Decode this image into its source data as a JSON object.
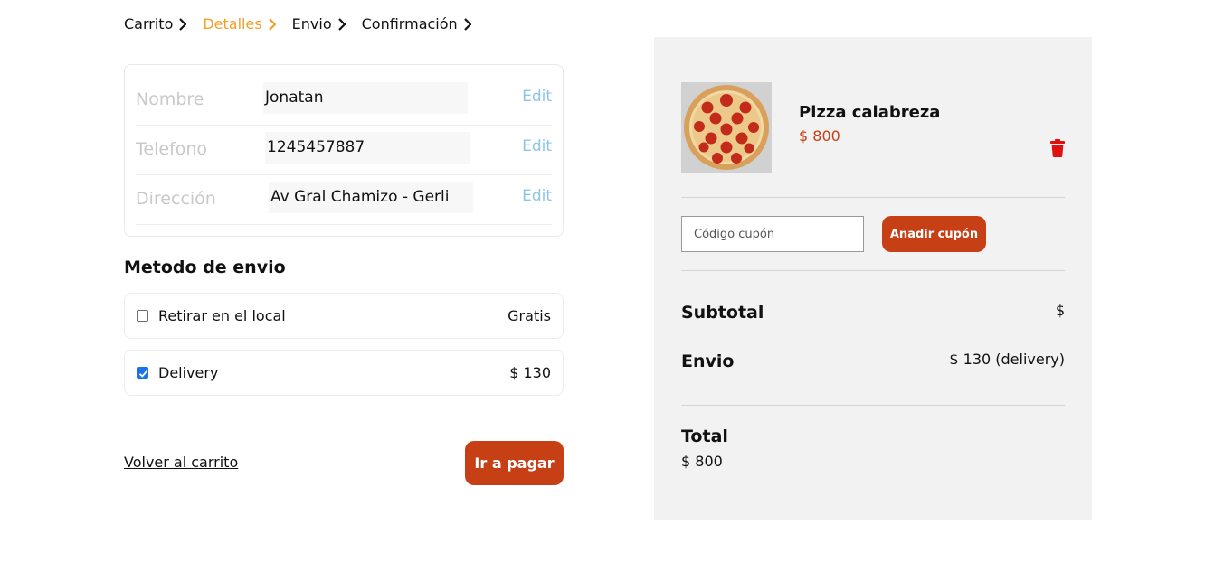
{
  "breadcrumb": [
    {
      "label": "Carrito",
      "active": false
    },
    {
      "label": "Detalles",
      "active": true
    },
    {
      "label": "Envio",
      "active": false
    },
    {
      "label": "Confirmación",
      "active": false
    }
  ],
  "details": {
    "name_label": "Nombre",
    "name_value": "Jonatan",
    "phone_label": "Telefono",
    "phone_value": "1245457887",
    "address_label": "Dirección",
    "address_value": "Av Gral Chamizo - Gerli",
    "edit_label": "Edit"
  },
  "shipping": {
    "title": "Metodo de envio",
    "options": [
      {
        "label": "Retirar en el local",
        "price": "Gratis",
        "checked": false
      },
      {
        "label": "Delivery",
        "price": "$ 130",
        "checked": true
      }
    ]
  },
  "actions": {
    "back_label": "Volver al carrito",
    "pay_label": "Ir a pagar"
  },
  "cart": {
    "item_name": "Pizza calabreza",
    "item_price": "$ 800",
    "item_image": "pizza-image",
    "delete_icon": "trash-icon"
  },
  "coupon": {
    "placeholder": "Código cupón",
    "button_label": "Añadir cupón"
  },
  "summary": {
    "subtotal_label": "Subtotal",
    "subtotal_value": "$",
    "envio_label": "Envio",
    "envio_value": "$ 130 (delivery)",
    "total_label": "Total",
    "total_value": "$ 800"
  },
  "colors": {
    "accent": "#c63f15",
    "breadcrumb_active": "#f0a026",
    "edit_link": "#8cc5ea",
    "panel_bg": "#f2f2f2",
    "trash": "#e01010"
  }
}
